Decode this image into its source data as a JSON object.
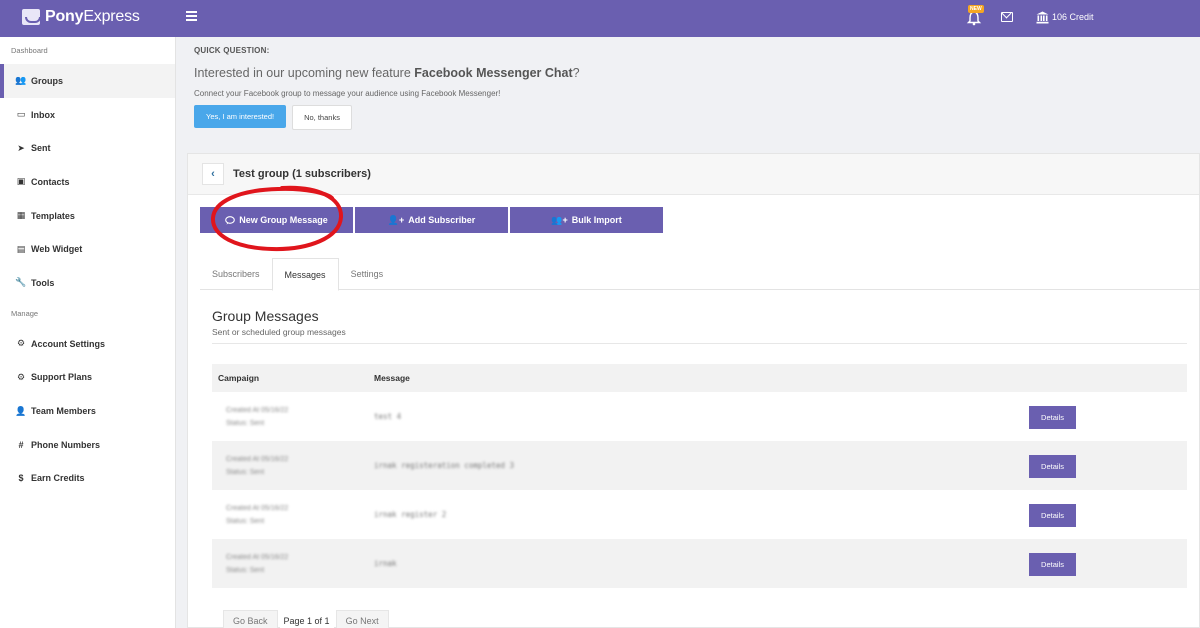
{
  "brand": {
    "name_bold": "Pony",
    "name_rest": "Express"
  },
  "topbar": {
    "badge": "NEW",
    "credit": "106 Credit"
  },
  "sidebar": {
    "section_dashboard": "Dashboard",
    "section_manage": "Manage",
    "items": [
      {
        "label": "Groups",
        "icon": "users-icon"
      },
      {
        "label": "Inbox",
        "icon": "inbox-icon"
      },
      {
        "label": "Sent",
        "icon": "paper-plane-icon"
      },
      {
        "label": "Contacts",
        "icon": "address-book-icon"
      },
      {
        "label": "Templates",
        "icon": "grid-icon"
      },
      {
        "label": "Web Widget",
        "icon": "widget-icon"
      },
      {
        "label": "Tools",
        "icon": "wrench-icon"
      }
    ],
    "manage_items": [
      {
        "label": "Account Settings",
        "icon": "gear-icon"
      },
      {
        "label": "Support Plans",
        "icon": "gear-icon"
      },
      {
        "label": "Team Members",
        "icon": "user-plus-icon"
      },
      {
        "label": "Phone Numbers",
        "icon": "hash-icon"
      },
      {
        "label": "Earn Credits",
        "icon": "dollar-icon"
      }
    ]
  },
  "question": {
    "label": "QUICK QUESTION:",
    "title_prefix": "Interested in our upcoming new feature ",
    "title_bold": "Facebook Messenger Chat",
    "title_suffix": "?",
    "subtitle": "Connect your Facebook group to message your audience using Facebook Messenger!",
    "yes_label": "Yes, I am interested!",
    "no_label": "No, thanks"
  },
  "group": {
    "back": "‹",
    "title": "Test group (1 subscribers)",
    "actions": {
      "new_message": "New Group Message",
      "add_subscriber": "Add Subscriber",
      "bulk_import": "Bulk Import"
    },
    "tabs": [
      "Subscribers",
      "Messages",
      "Settings"
    ],
    "active_tab": "Messages"
  },
  "messages": {
    "title": "Group Messages",
    "subtitle": "Sent or scheduled group messages",
    "columns": [
      "Campaign",
      "Message"
    ],
    "rows": [
      {
        "created": "Created At 05/16/22",
        "status": "Status: Sent",
        "message": "test 4",
        "action": "Details"
      },
      {
        "created": "Created At 05/16/22",
        "status": "Status: Sent",
        "message": "irnak registeration completed 3",
        "action": "Details"
      },
      {
        "created": "Created At 05/16/22",
        "status": "Status: Sent",
        "message": "irnak register 2",
        "action": "Details"
      },
      {
        "created": "Created At 05/16/22",
        "status": "Status: Sent",
        "message": "irnak",
        "action": "Details"
      }
    ]
  },
  "pagination": {
    "prev": "Go Back",
    "current": "Page 1 of 1",
    "next": "Go Next"
  },
  "colors": {
    "brand": "#6a5fb0",
    "accent_blue": "#49a7ea",
    "annotation_red": "#e0151c"
  }
}
